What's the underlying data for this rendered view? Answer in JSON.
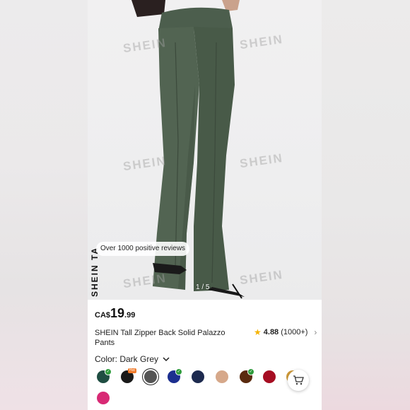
{
  "photo": {
    "watermark_text": "SHEIN",
    "brand_vertical": "SHEIN TA",
    "review_badge": "Over 1000 positive reviews",
    "image_counter": "1 / 5"
  },
  "product": {
    "currency": "CA$",
    "price_main": "19",
    "price_decimal": ".99",
    "title": "SHEIN Tall Zipper Back Solid Palazzo Pants",
    "rating_score": "4.88",
    "rating_count": "(1000+)",
    "color_label": "Color: Dark Grey",
    "hot_tag": "Hot",
    "swatch_colors": [
      "#1f4d42",
      "#1a1a1a",
      "#555555",
      "#1c2f8f",
      "#1d2a4f",
      "#d6a88a",
      "#5a2a0e",
      "#a60d22",
      "#d09b3a",
      "#d82a75"
    ],
    "accent_color": "#f5b301"
  }
}
